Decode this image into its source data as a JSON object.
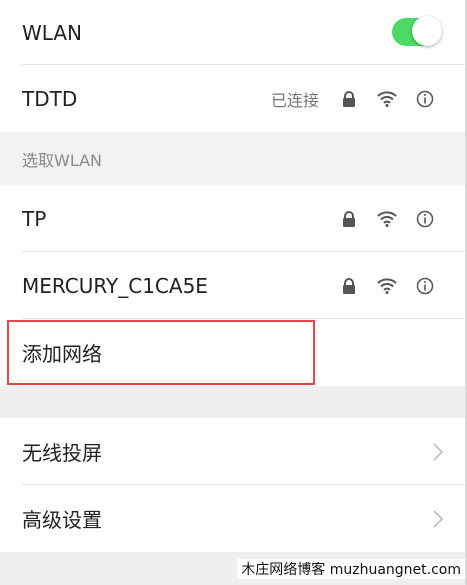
{
  "wlan": {
    "label": "WLAN",
    "enabled": true
  },
  "connected": {
    "ssid": "TDTD",
    "status": "已连接",
    "icons": [
      "lock-icon",
      "wifi-icon",
      "info-icon"
    ]
  },
  "section": {
    "title": "选取WLAN"
  },
  "networks": [
    {
      "ssid": "TP",
      "icons": [
        "lock-icon",
        "wifi-icon",
        "info-icon"
      ]
    },
    {
      "ssid": "MERCURY_C1CA5E",
      "icons": [
        "lock-icon",
        "wifi-icon",
        "info-icon"
      ]
    }
  ],
  "add_network": {
    "label": "添加网络"
  },
  "menu": [
    {
      "label": "无线投屏",
      "icon": "chevron-right-icon"
    },
    {
      "label": "高级设置",
      "icon": "chevron-right-icon"
    }
  ],
  "watermark": {
    "text": "木庄网络博客 muzhuangnet.com"
  },
  "colors": {
    "toggle_on": "#4cd964",
    "highlight": "#e0484a",
    "background": "#efefef"
  }
}
